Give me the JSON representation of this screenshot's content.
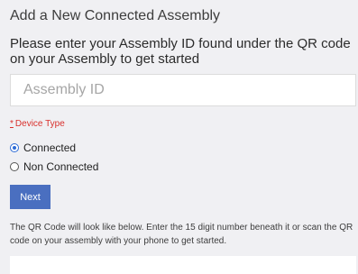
{
  "form": {
    "title": "Add a New Connected Assembly",
    "subtitle": "Please enter your Assembly ID found under the QR code on your Assembly to get started",
    "assembly_id": {
      "value": "",
      "placeholder": "Assembly ID"
    },
    "device_type": {
      "required_marker": "*",
      "label": "Device Type"
    },
    "options": [
      {
        "label": "Connected",
        "checked": true
      },
      {
        "label": "Non Connected",
        "checked": false
      }
    ],
    "next_label": "Next",
    "helper_text": "The QR Code will look like below. Enter the 15 digit number beneath it or scan the QR code on your assembly with your phone to get started."
  },
  "colors": {
    "accent": "#4a6fc0",
    "required": "#d9302c",
    "radio_selected": "#2c6bd6"
  }
}
